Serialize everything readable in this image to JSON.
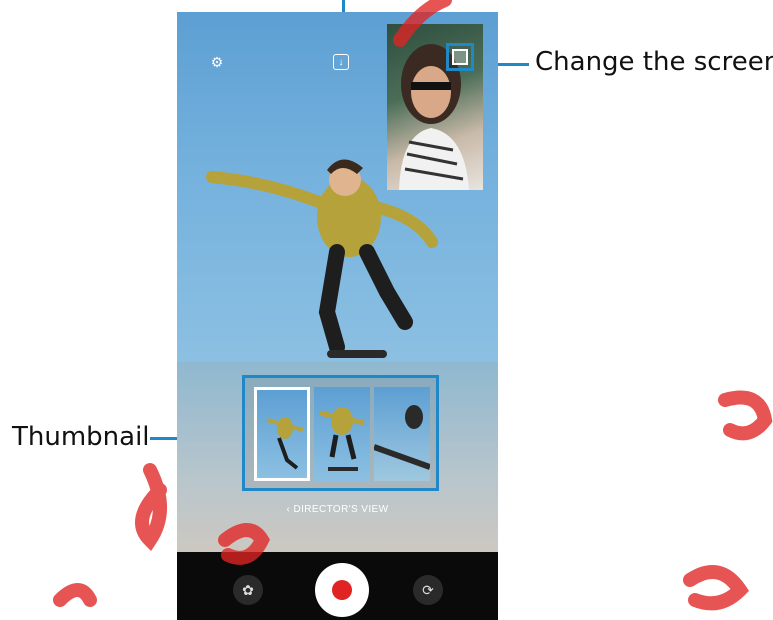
{
  "callouts": {
    "change_screen": "Change the screen.",
    "thumbnail": "Thumbnail"
  },
  "camera": {
    "settings_icon": "gear-icon",
    "save_icon": "download-icon",
    "director_view_label": "DIRECTOR'S VIEW",
    "director_view_chevron": "‹",
    "effects_icon": "flower-icon",
    "record_icon": "record-icon",
    "switch_camera_icon": "rotate-icon"
  },
  "colors": {
    "callout_line": "#1e88c8",
    "record": "#e02424",
    "bar": "#0a0a0a"
  }
}
